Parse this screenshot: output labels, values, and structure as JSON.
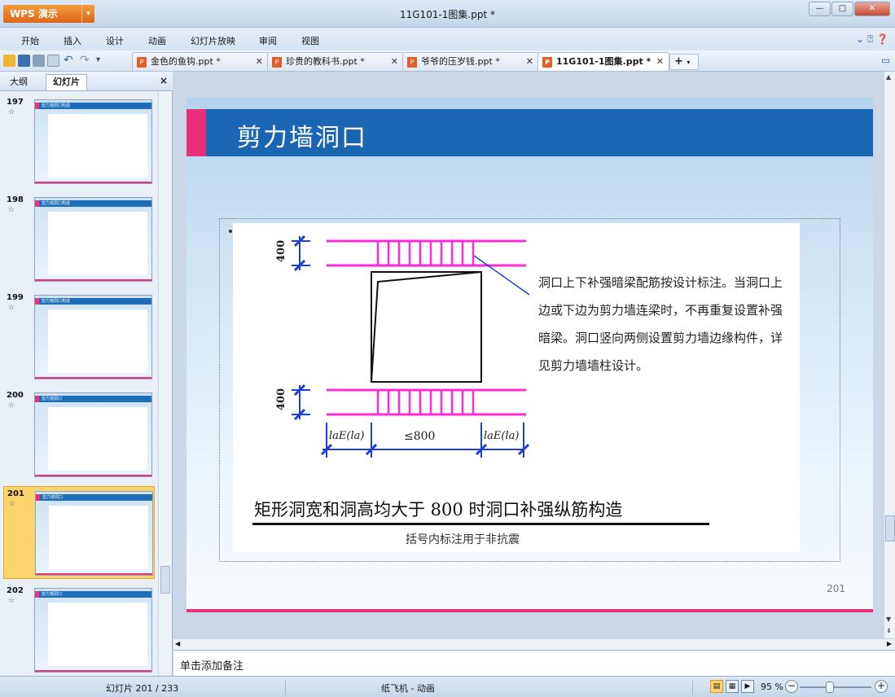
{
  "app": {
    "name": "WPS 演示",
    "window_title": "11G101-1图集.ppt *"
  },
  "menu": [
    "开始",
    "插入",
    "设计",
    "动画",
    "幻灯片放映",
    "审阅",
    "视图"
  ],
  "doc_tabs": [
    {
      "label": "金色的鱼钩.ppt *",
      "active": false
    },
    {
      "label": "珍贵的教科书.ppt *",
      "active": false
    },
    {
      "label": "爷爷的压岁钱.ppt *",
      "active": false
    },
    {
      "label": "11G101-1图集.ppt *",
      "active": true
    }
  ],
  "panel": {
    "tab_outline": "大纲",
    "tab_slides": "幻灯片",
    "close": "×"
  },
  "thumbnails": [
    {
      "number": "197",
      "title": "剪力墙洞口构造",
      "selected": false
    },
    {
      "number": "198",
      "title": "剪力墙洞口构造",
      "selected": false
    },
    {
      "number": "199",
      "title": "剪力墙洞口构造",
      "selected": false
    },
    {
      "number": "200",
      "title": "剪力墙洞口",
      "selected": false
    },
    {
      "number": "201",
      "title": "剪力墙洞口",
      "selected": true
    },
    {
      "number": "202",
      "title": "剪力墙洞口",
      "selected": false
    }
  ],
  "slide": {
    "title": "剪力墙洞口",
    "description": "洞口上下补强暗梁配筋按设计标注。当洞口上边或下边为剪力墙连梁时，不再重复设置补强暗梁。洞口竖向两侧设置剪力墙边缘构件，详见剪力墙墙柱设计。",
    "dim_top": "400",
    "dim_bottom": "400",
    "dim_width": "≤800",
    "dim_lae_left": "laE(la)",
    "dim_lae_right": "laE(la)",
    "caption": "矩形洞宽和洞高均大于 800 时洞口补强纵筋构造",
    "subcaption": "括号内标注用于非抗震",
    "page_number": "201"
  },
  "notes_placeholder": "单击添加备注",
  "status": {
    "slide_indicator": "幻灯片 201 / 233",
    "theme": "纸飞机 - 动画",
    "zoom": "95 %"
  },
  "colors": {
    "accent_blue": "#1a66b2",
    "accent_pink": "#e8307a",
    "rebar_magenta": "#ff2bd6",
    "dim_blue": "#1e3ed8"
  }
}
